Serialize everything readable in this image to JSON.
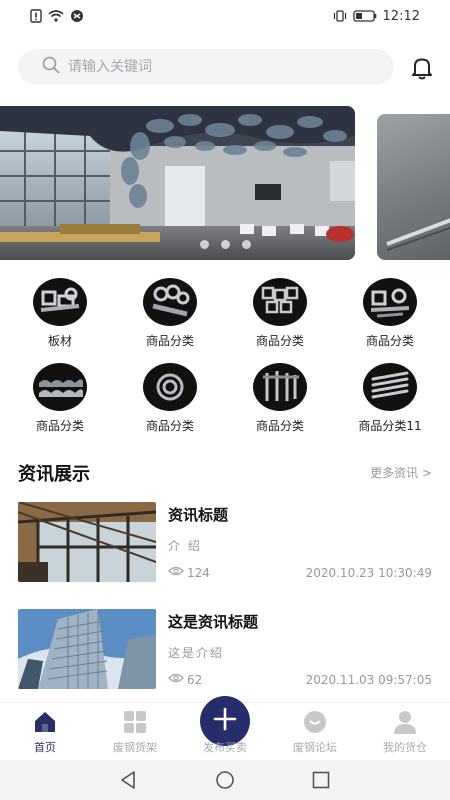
{
  "status": {
    "time": "12:12"
  },
  "search": {
    "placeholder": "请输入关键词"
  },
  "categories": [
    {
      "label": "板材"
    },
    {
      "label": "商品分类"
    },
    {
      "label": "商品分类"
    },
    {
      "label": "商品分类"
    },
    {
      "label": "商品分类"
    },
    {
      "label": "商品分类"
    },
    {
      "label": "商品分类"
    },
    {
      "label": "商品分类11"
    }
  ],
  "news": {
    "title": "资讯展示",
    "more": "更多资讯 >",
    "items": [
      {
        "title": "资讯标题",
        "intro": "介 绍",
        "views": "124",
        "date": "2020.10.23 10:30:49"
      },
      {
        "title": "这是资讯标题",
        "intro": "这是介绍",
        "views": "62",
        "date": "2020.11.03 09:57:05"
      }
    ]
  },
  "tabs": [
    {
      "label": "首页"
    },
    {
      "label": "废钢货架"
    },
    {
      "label": "发布买卖"
    },
    {
      "label": "废钢论坛"
    },
    {
      "label": "我的货仓"
    }
  ],
  "colors": {
    "accent": "#262d6b",
    "muted": "#999999"
  }
}
